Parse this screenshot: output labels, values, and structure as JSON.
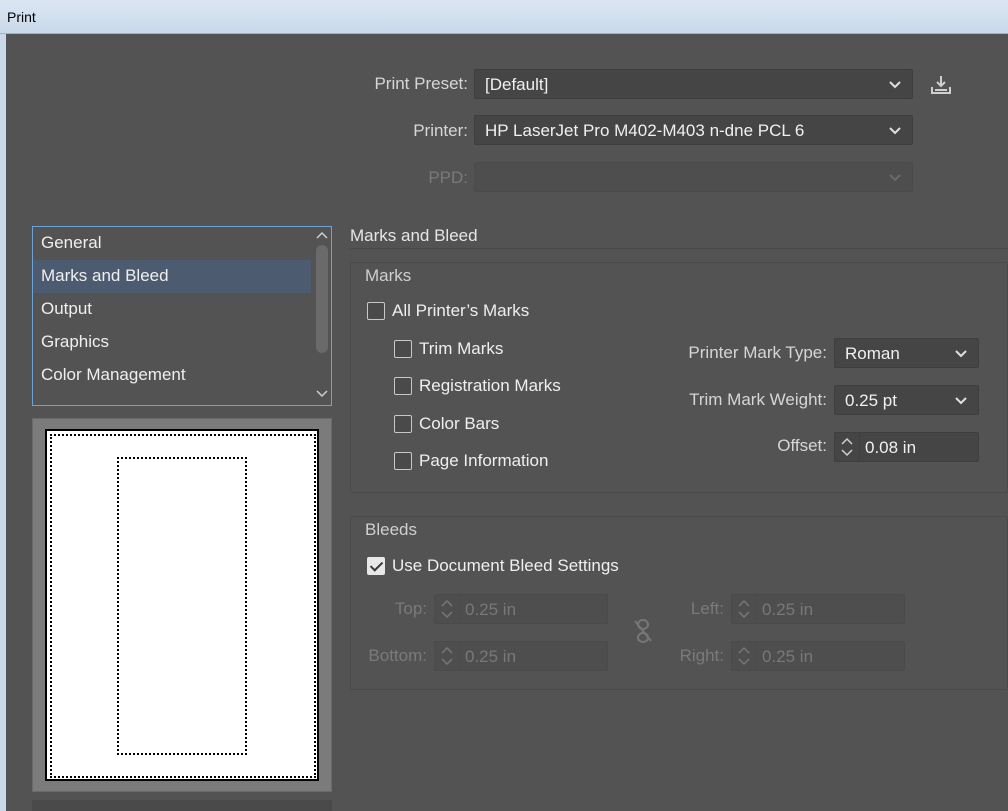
{
  "window": {
    "title": "Print"
  },
  "header": {
    "print_preset_label": "Print Preset:",
    "print_preset_value": "[Default]",
    "printer_label": "Printer:",
    "printer_value": "HP LaserJet Pro M402-M403 n-dne PCL 6",
    "ppd_label": "PPD:",
    "ppd_value": ""
  },
  "sidebar": {
    "items": [
      {
        "label": "General",
        "selected": false
      },
      {
        "label": "Marks and Bleed",
        "selected": true
      },
      {
        "label": "Output",
        "selected": false
      },
      {
        "label": "Graphics",
        "selected": false
      },
      {
        "label": "Color Management",
        "selected": false
      }
    ]
  },
  "main": {
    "section_title": "Marks and Bleed",
    "marks": {
      "title": "Marks",
      "all_printers_marks": {
        "label": "All Printer’s Marks",
        "checked": false
      },
      "trim_marks": {
        "label": "Trim Marks",
        "checked": false
      },
      "registration_marks": {
        "label": "Registration Marks",
        "checked": false
      },
      "color_bars": {
        "label": "Color Bars",
        "checked": false
      },
      "page_information": {
        "label": "Page Information",
        "checked": false
      },
      "printer_mark_type_label": "Printer Mark Type:",
      "printer_mark_type_value": "Roman",
      "trim_mark_weight_label": "Trim Mark Weight:",
      "trim_mark_weight_value": "0.25 pt",
      "offset_label": "Offset:",
      "offset_value": "0.08 in"
    },
    "bleeds": {
      "title": "Bleeds",
      "use_document_bleed": {
        "label": "Use Document Bleed Settings",
        "checked": true
      },
      "top_label": "Top:",
      "top_value": "0.25 in",
      "bottom_label": "Bottom:",
      "bottom_value": "0.25 in",
      "left_label": "Left:",
      "left_value": "0.25 in",
      "right_label": "Right:",
      "right_value": "0.25 in"
    }
  },
  "colors": {
    "dialog_bg": "#535353",
    "selection": "#4d5b70",
    "focus_border": "#6ea3d8"
  }
}
